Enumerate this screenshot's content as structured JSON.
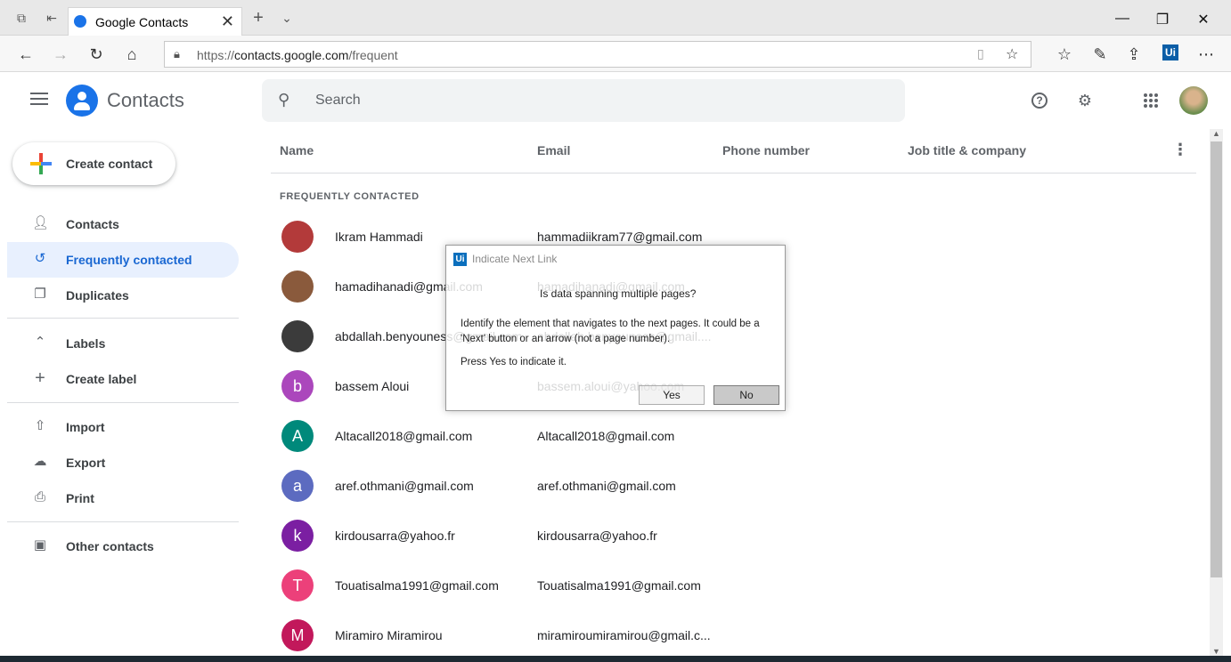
{
  "browser": {
    "tab_title": "Google Contacts",
    "url": "https://contacts.google.com/frequent",
    "url_host": "contacts.google.com",
    "url_scheme": "https://",
    "url_path": "/frequent",
    "ext_badge": "Ui"
  },
  "app": {
    "name": "Contacts",
    "search_placeholder": "Search"
  },
  "sidebar": {
    "create_label": "Create contact",
    "items": [
      {
        "label": "Contacts",
        "icon": "person-icon"
      },
      {
        "label": "Frequently contacted",
        "icon": "history-icon",
        "active": true
      },
      {
        "label": "Duplicates",
        "icon": "duplicates-icon"
      },
      {
        "label": "Labels",
        "icon": "chevron-up-icon"
      },
      {
        "label": "Create label",
        "icon": "plus-icon"
      },
      {
        "label": "Import",
        "icon": "upload-icon"
      },
      {
        "label": "Export",
        "icon": "cloud-download-icon"
      },
      {
        "label": "Print",
        "icon": "printer-icon"
      },
      {
        "label": "Other contacts",
        "icon": "archive-icon"
      }
    ]
  },
  "table": {
    "columns": [
      "Name",
      "Email",
      "Phone number",
      "Job title & company"
    ],
    "section": "FREQUENTLY CONTACTED",
    "rows": [
      {
        "name": "Ikram Hammadi",
        "email": "hammadiikram77@gmail.com",
        "initial": "",
        "color": "#b33a3a"
      },
      {
        "name": "hamadihanadi@gmail.com",
        "email": "hamadihanadi@gmail.com",
        "initial": "",
        "color": "#8a5a3c"
      },
      {
        "name": "abdallah.benyouness@gmail.com",
        "email": "abdallah.benyouness@gmail....",
        "initial": "",
        "color": "#3b3b3b"
      },
      {
        "name": "bassem Aloui",
        "email": "bassem.aloui@yahoo.com",
        "initial": "b",
        "color": "#ab47bc"
      },
      {
        "name": "Altacall2018@gmail.com",
        "email": "Altacall2018@gmail.com",
        "initial": "A",
        "color": "#00897b"
      },
      {
        "name": "aref.othmani@gmail.com",
        "email": "aref.othmani@gmail.com",
        "initial": "a",
        "color": "#5c6bc0"
      },
      {
        "name": "kirdousarra@yahoo.fr",
        "email": "kirdousarra@yahoo.fr",
        "initial": "k",
        "color": "#7b1fa2"
      },
      {
        "name": "Touatisalma1991@gmail.com",
        "email": "Touatisalma1991@gmail.com",
        "initial": "T",
        "color": "#ec407a"
      },
      {
        "name": "Miramiro Miramirou",
        "email": "miramiroumiramirou@gmail.c...",
        "initial": "M",
        "color": "#c2185b"
      }
    ]
  },
  "dialog": {
    "logo": "Ui",
    "title": "Indicate Next Link",
    "question": "Is data spanning multiple pages?",
    "body": "Identify the element that navigates to the next pages. It could be a 'Next' button or an arrow (not a page number).",
    "prompt": "Press Yes to indicate it.",
    "yes": "Yes",
    "no": "No"
  }
}
